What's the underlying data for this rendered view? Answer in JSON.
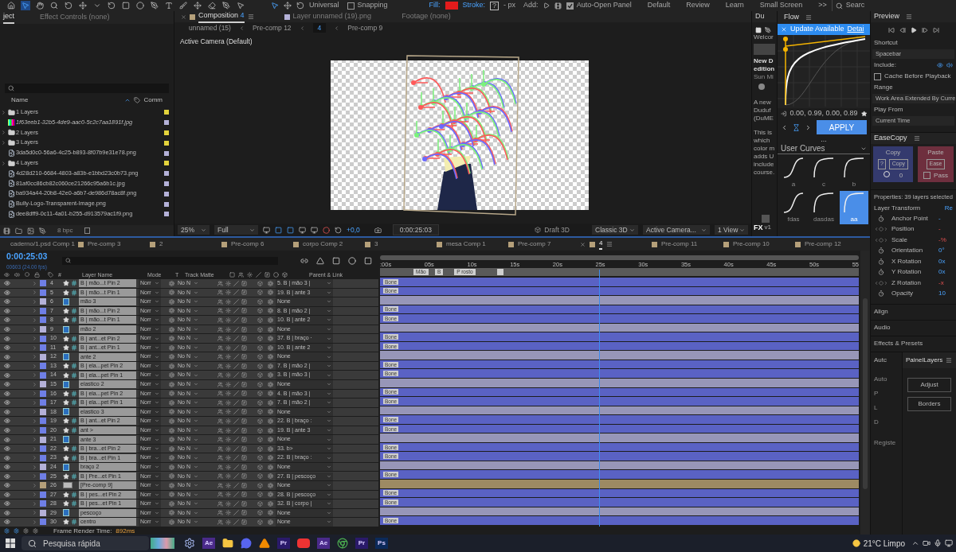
{
  "toolbar": {
    "axis_mode": "Universal",
    "snapping": {
      "label": "Snapping",
      "checked": false
    },
    "fill_label": "Fill:",
    "stroke_label": "Stroke:",
    "stroke_value": "?",
    "stroke_width": "- px",
    "add_label": "Add:",
    "auto_open": {
      "label": "Auto-Open Panel",
      "checked": true
    },
    "workspaces": [
      {
        "label": "Default",
        "selected": false
      },
      {
        "label": "Review",
        "selected": false
      },
      {
        "label": "Learn",
        "selected": false
      },
      {
        "label": "Small Screen",
        "selected": false
      }
    ],
    "more": ">>",
    "search_placeholder": "Searc"
  },
  "project": {
    "tabs": [
      {
        "label": "ject",
        "selected": true
      },
      {
        "label": "Effect Controls (none)",
        "selected": false
      }
    ],
    "columns": [
      "Name",
      "Comm"
    ],
    "items": [
      {
        "kind": "folder",
        "name": "1 Layers",
        "color": "#e3d33c"
      },
      {
        "kind": "missing",
        "name": "1f63eeb1-32b5-4de9-aac0-5c2c7aa1891f.jpg",
        "color": "#b4b1d8"
      },
      {
        "kind": "folder",
        "name": "2 Layers",
        "color": "#e3d33c"
      },
      {
        "kind": "folder",
        "name": "3 Layers",
        "color": "#e3d33c"
      },
      {
        "kind": "image",
        "name": "3da5d0c0-56a6-4c25-b893-8f07b9e31e78.png",
        "color": "#b4b1d8"
      },
      {
        "kind": "folder",
        "name": "4 Layers",
        "color": "#e3d33c"
      },
      {
        "kind": "image",
        "name": "4d28d210-6684-4803-a83b-e1bbd23c0b73.png",
        "color": "#b4b1d8"
      },
      {
        "kind": "image",
        "name": "81af0cc86cb82c060ce21266c95a6b1c.jpg",
        "color": "#b4b1d8"
      },
      {
        "kind": "image",
        "name": "ba934a44-20b8-42e0-a6b7-de986d78ac8f.png",
        "color": "#b4b1d8"
      },
      {
        "kind": "image",
        "name": "Bully-Logo-Transparent-Image.png",
        "color": "#b4b1d8"
      },
      {
        "kind": "image",
        "name": "dee8dff9-0c11-4a01-b255-d913579ac1f9.png",
        "color": "#b4b1d8"
      }
    ],
    "bit_depth": "8 bpc"
  },
  "composition": {
    "tabs": [
      {
        "label": "Composition",
        "suffix": "4",
        "selected": true
      },
      {
        "label": "Layer unnamed (19).png",
        "selected": false
      },
      {
        "label": "Footage (none)",
        "selected": false
      }
    ],
    "breadcrumbs": [
      {
        "label": "unnamed (15)",
        "selected": false
      },
      {
        "label": "Pre-comp 12",
        "selected": false
      },
      {
        "label": "4",
        "selected": true
      },
      {
        "label": "Pre-comp 9",
        "selected": false
      }
    ],
    "view_label": "Active Camera (Default)",
    "bottom_bar": {
      "zoom": "25%",
      "resolution": "Full",
      "exposure": "+0,0",
      "timecode": "0:00:25:03",
      "draft": "Draft 3D",
      "renderer": "Classic 3D",
      "camera": "Active Camera...",
      "views": "1 View"
    }
  },
  "du_panel": {
    "tab": "Du",
    "lines": [
      "Welcor",
      "New D",
      "edition",
      "Sun Mi",
      "A new",
      "Duduf",
      "(DuME",
      "This is",
      "which",
      "color m",
      "adds U",
      "include",
      "course."
    ],
    "logo": "FX",
    "version": "v1"
  },
  "flow": {
    "title": "Flow",
    "banner": {
      "label": "Update Available",
      "link": "Detai"
    },
    "values": "0.00, 0.99, 0.00, 0.89",
    "apply": "APPLY",
    "more": "...",
    "curves_label": "User Curves",
    "presets": [
      {
        "label": "a",
        "selected": false
      },
      {
        "label": "c",
        "selected": false
      },
      {
        "label": "b",
        "selected": false
      },
      {
        "label": "fdas",
        "selected": false
      },
      {
        "label": "dasdas",
        "selected": false
      },
      {
        "label": "aa",
        "selected": true
      }
    ]
  },
  "preview": {
    "title": "Preview",
    "shortcut_label": "Shortcut",
    "shortcut": "Spacebar",
    "include_label": "Include:",
    "cache": {
      "label": "Cache Before Playback",
      "checked": false
    },
    "range_label": "Range",
    "range": "Work Area Extended By Curre",
    "play_from_label": "Play From",
    "play_from": "Current Time"
  },
  "easecopy": {
    "title": "EaseCopy",
    "copy_label": "Copy",
    "help": "?",
    "copy_button": "Copy",
    "count": "0",
    "paste_label": "Paste",
    "ease_button": "Ease",
    "pass": {
      "label": "Pass",
      "checked": false
    }
  },
  "properties": {
    "title": "Properties: 39 layers selected",
    "section": "Layer Transform",
    "reset": "Re",
    "rows": [
      {
        "label": "Anchor Point",
        "animated": false,
        "value": "-"
      },
      {
        "label": "Position",
        "animated": true,
        "value": "-"
      },
      {
        "label": "Scale",
        "animated": true,
        "value": "-%"
      },
      {
        "label": "Orientation",
        "animated": false,
        "value": "0°"
      },
      {
        "label": "X Rotation",
        "animated": false,
        "value": "0x"
      },
      {
        "label": "Y Rotation",
        "animated": false,
        "value": "0x"
      },
      {
        "label": "Z Rotation",
        "animated": true,
        "value": "-x"
      },
      {
        "label": "Opacity",
        "animated": false,
        "value": "10"
      }
    ]
  },
  "collapsed_panels": [
    "Align",
    "Audio",
    "Effects & Presets"
  ],
  "bottom_panels": {
    "tabs": [
      {
        "label": "Autc",
        "selected": false
      },
      {
        "label": "PainelLayers",
        "selected": true
      }
    ],
    "left_labels": [
      "Auto",
      "P",
      "L",
      "D"
    ],
    "register": "Registe",
    "buttons": [
      "Adjust",
      "Borders"
    ]
  },
  "timeline": {
    "tabs": [
      {
        "label": "caderno/1.psd Comp 1",
        "selected": false
      },
      {
        "label": "Pre-comp 3",
        "selected": false
      },
      {
        "label": "2",
        "selected": false
      },
      {
        "label": "Pre-comp 6",
        "selected": false
      },
      {
        "label": "corpo Comp 2",
        "selected": false
      },
      {
        "label": "3",
        "selected": false
      },
      {
        "label": "mesa Comp 1",
        "selected": false
      },
      {
        "label": "Pre-comp 7",
        "selected": false
      },
      {
        "label": "4",
        "selected": true
      },
      {
        "label": "Pre-comp 11",
        "selected": false
      },
      {
        "label": "Pre-comp 10",
        "selected": false
      },
      {
        "label": "Pre-comp 12",
        "selected": false
      }
    ],
    "timecode": "0:00:25:03",
    "frame_info": "00603 (24.00 fps)",
    "columns": {
      "number": "#",
      "name": "Layer Name",
      "mode": "Mode",
      "t": "T",
      "matte": "Track Matte",
      "parent": "Parent & Link"
    },
    "ticks": [
      ":00s",
      "05s",
      "10s",
      "15s",
      "20s",
      "25s",
      "30s",
      "35s",
      "40s",
      "45s",
      "50s",
      "55"
    ],
    "playhead": {
      "level": 0.4575
    },
    "markers": [
      {
        "label": "Mão",
        "level": 0.07
      },
      {
        "label": "B",
        "level": 0.115
      },
      {
        "label": "P rosto",
        "level": 0.155
      },
      {
        "level": 0.245
      }
    ],
    "layers": [
      {
        "number": "4",
        "kind": "pin",
        "name": "B | mão...t Pin 2",
        "mode": "Norr",
        "matte": "No N",
        "parent": "5. B | mão 3 |",
        "bar_label": "Bone",
        "selected": true,
        "color": "#6f7fe6"
      },
      {
        "number": "5",
        "kind": "pin",
        "name": "B | mão...t Pin 1",
        "mode": "Norr",
        "matte": "No N",
        "parent": "19. B | ante 3",
        "bar_label": "Bone",
        "selected": true,
        "color": "#6f7fe6"
      },
      {
        "number": "6",
        "kind": "puppet",
        "name": "mão 3",
        "mode": "Norr",
        "matte": "No N",
        "parent": "None",
        "selected": true,
        "color": "#b4b1d8"
      },
      {
        "number": "7",
        "kind": "pin",
        "name": "B | mão...t Pin 2",
        "mode": "Norr",
        "matte": "No N",
        "parent": "8. B | mão 2 |",
        "bar_label": "Bone",
        "selected": true,
        "color": "#6f7fe6"
      },
      {
        "number": "8",
        "kind": "pin",
        "name": "B | mão...t Pin 1",
        "mode": "Norr",
        "matte": "No N",
        "parent": "10. B | ante 2",
        "bar_label": "Bone",
        "selected": true,
        "color": "#6f7fe6"
      },
      {
        "number": "9",
        "kind": "puppet",
        "name": "mão 2",
        "mode": "Norr",
        "matte": "No N",
        "parent": "None",
        "selected": true,
        "color": "#b4b1d8"
      },
      {
        "number": "10",
        "kind": "pin",
        "name": "B | ant...et Pin 2",
        "mode": "Norr",
        "matte": "No N",
        "parent": "37. B | braço ·",
        "bar_label": "Bone",
        "selected": true,
        "color": "#6f7fe6"
      },
      {
        "number": "11",
        "kind": "pin",
        "name": "B | ant...et Pin 1",
        "mode": "Norr",
        "matte": "No N",
        "parent": "10. B | ante 2",
        "bar_label": "Bone",
        "selected": true,
        "color": "#6f7fe6"
      },
      {
        "number": "12",
        "kind": "puppet",
        "name": "ante 2",
        "mode": "Norr",
        "matte": "No N",
        "parent": "None",
        "selected": true,
        "color": "#b4b1d8"
      },
      {
        "number": "13",
        "kind": "pin",
        "name": "B | ela...pet Pin 2",
        "mode": "Norr",
        "matte": "No N",
        "parent": "7. B | mão 2 |",
        "bar_label": "Bone",
        "selected": true,
        "color": "#6f7fe6"
      },
      {
        "number": "14",
        "kind": "pin",
        "name": "B | ela...pet Pin 1",
        "mode": "Norr",
        "matte": "No N",
        "parent": "3. B | mão 3 |",
        "bar_label": "Bone",
        "selected": true,
        "color": "#6f7fe6"
      },
      {
        "number": "15",
        "kind": "puppet",
        "name": "elastico 2",
        "mode": "Norr",
        "matte": "No N",
        "parent": "None",
        "selected": true,
        "color": "#b4b1d8"
      },
      {
        "number": "16",
        "kind": "pin",
        "name": "B | ela...pet Pin 2",
        "mode": "Norr",
        "matte": "No N",
        "parent": "4. B | mão 3 |",
        "bar_label": "Bone",
        "selected": true,
        "color": "#6f7fe6"
      },
      {
        "number": "17",
        "kind": "pin",
        "name": "B | ela...pet Pin 1",
        "mode": "Norr",
        "matte": "No N",
        "parent": "7. B | mão 2 |",
        "bar_label": "Bone",
        "selected": true,
        "color": "#6f7fe6"
      },
      {
        "number": "18",
        "kind": "puppet",
        "name": "elastico 3",
        "mode": "Norr",
        "matte": "No N",
        "parent": "None",
        "selected": true,
        "color": "#b4b1d8"
      },
      {
        "number": "19",
        "kind": "pin",
        "name": "B | ant...et Pin 2",
        "mode": "Norr",
        "matte": "No N",
        "parent": "22. B | braço :",
        "bar_label": "Bone",
        "selected": true,
        "color": "#6f7fe6"
      },
      {
        "number": "20",
        "kind": "pin",
        "name": "ant >",
        "mode": "Norr",
        "matte": "No N",
        "parent": "19. B | ante 3",
        "bar_label": "Bone",
        "selected": true,
        "color": "#6f7fe6"
      },
      {
        "number": "21",
        "kind": "puppet",
        "name": "ante 3",
        "mode": "Norr",
        "matte": "No N",
        "parent": "None",
        "selected": true,
        "color": "#b4b1d8"
      },
      {
        "number": "22",
        "kind": "pin",
        "name": "B | bra...et Pin 2",
        "mode": "Norr",
        "matte": "No N",
        "parent": "33. b>",
        "bar_label": "Bone",
        "selected": true,
        "color": "#6f7fe6"
      },
      {
        "number": "23",
        "kind": "pin",
        "name": "B | bra...et Pin 1",
        "mode": "Norr",
        "matte": "No N",
        "parent": "22. B | braço :",
        "bar_label": "Bone",
        "selected": true,
        "color": "#6f7fe6"
      },
      {
        "number": "24",
        "kind": "puppet",
        "name": "braço 2",
        "mode": "Norr",
        "matte": "No N",
        "parent": "None",
        "selected": true,
        "color": "#b4b1d8"
      },
      {
        "number": "25",
        "kind": "pin",
        "name": "B | Pre...et Pin 1",
        "mode": "Norr",
        "matte": "No N",
        "parent": "27. B | pescoço",
        "bar_label": "Bone",
        "selected": true,
        "color": "#6f7fe6"
      },
      {
        "number": "26",
        "kind": "precomp",
        "name": "[Pre-comp 9]",
        "mode": "Norr",
        "matte": "No N",
        "parent": "None",
        "selected": true,
        "color": "#b5a07a"
      },
      {
        "number": "27",
        "kind": "pin",
        "name": "B | pes...et Pin 2",
        "mode": "Norr",
        "matte": "No N",
        "parent": "28. B | pescoço",
        "bar_label": "Bone",
        "selected": true,
        "color": "#6f7fe6"
      },
      {
        "number": "28",
        "kind": "pin",
        "name": "B | pes...et Pin 1",
        "mode": "Norr",
        "matte": "No N",
        "parent": "32. B | corpo |",
        "bar_label": "Bone",
        "selected": true,
        "color": "#6f7fe6"
      },
      {
        "number": "29",
        "kind": "puppet",
        "name": "pescoço",
        "mode": "Norr",
        "matte": "No N",
        "parent": "None",
        "selected": true,
        "color": "#b4b1d8"
      },
      {
        "number": "30",
        "kind": "pin",
        "name": "centro",
        "mode": "Norr",
        "matte": "No N",
        "parent": "None",
        "bar_label": "Bone",
        "selected": true,
        "color": "#6f7fe6"
      }
    ],
    "render_label": "Frame Render Time:",
    "render_time": "892ms"
  },
  "taskbar": {
    "search_placeholder": "Pesquisa rápida",
    "apps": [
      {
        "kind": "gear"
      },
      {
        "kind": "letter",
        "label": "Ae",
        "color": "#4a2a8a"
      },
      {
        "kind": "folder"
      },
      {
        "kind": "chat"
      },
      {
        "kind": "cone"
      },
      {
        "kind": "letter",
        "label": "Pr",
        "color": "#2a1a6a"
      },
      {
        "kind": "record"
      },
      {
        "kind": "letter",
        "label": "Ae",
        "color": "#4a2a8a"
      },
      {
        "kind": "browser"
      },
      {
        "kind": "letter",
        "label": "Pr",
        "color": "#2a1a6a"
      },
      {
        "kind": "letter",
        "label": "Ps",
        "color": "#0c2a5a"
      }
    ],
    "weather": "21°C Limpo"
  }
}
